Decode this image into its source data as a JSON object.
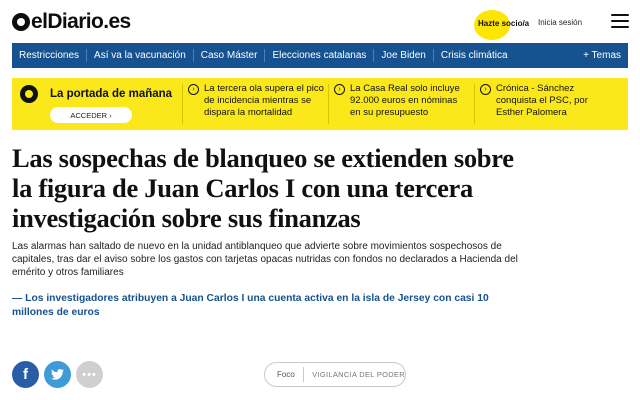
{
  "header": {
    "logo_text": "elDiario.es",
    "subscribe_label": "Hazte socio/a",
    "login_label": "Inicia sesión"
  },
  "nav": {
    "items": [
      "Restricciones",
      "Así va la vacunación",
      "Caso Máster",
      "Elecciones catalanas",
      "Joe Biden",
      "Crisis climática"
    ],
    "more_label": "+ Temas"
  },
  "portada": {
    "title": "La portada de mañana",
    "button_label": "ACCEDER ›",
    "headlines": [
      "La tercera ola supera el pico de incidencia mientras se dispara la mortalidad",
      "La Casa Real solo incluye 92.000 euros en nóminas en su presupuesto",
      "Crónica - Sánchez conquista el PSC, por Esther Palomera"
    ]
  },
  "article": {
    "title": "Las sospechas de blanqueo se extienden sobre la figura de Juan Carlos I con una tercera investigación sobre sus finanzas",
    "lead": "Las alarmas han saltado de nuevo en la unidad antiblanqueo que advierte sobre movimientos sospechosos de capitales, tras dar el aviso sobre los gastos con tarjetas opacas nutridas con fondos no declarados a Hacienda del emérito y otros familiares",
    "related": "— Los investigadores atribuyen a Juan Carlos I una cuenta activa en la isla de Jersey con casi 10 millones de euros"
  },
  "share": {
    "facebook_glyph": "f",
    "more_glyph": "•••"
  },
  "foco": {
    "label": "Foco",
    "value": "VIGILANCIA DEL PODER"
  },
  "colors": {
    "nav_blue": "#15528f",
    "band_yellow": "#fae81a",
    "facebook": "#2a5da8",
    "twitter": "#3d9bd8"
  }
}
